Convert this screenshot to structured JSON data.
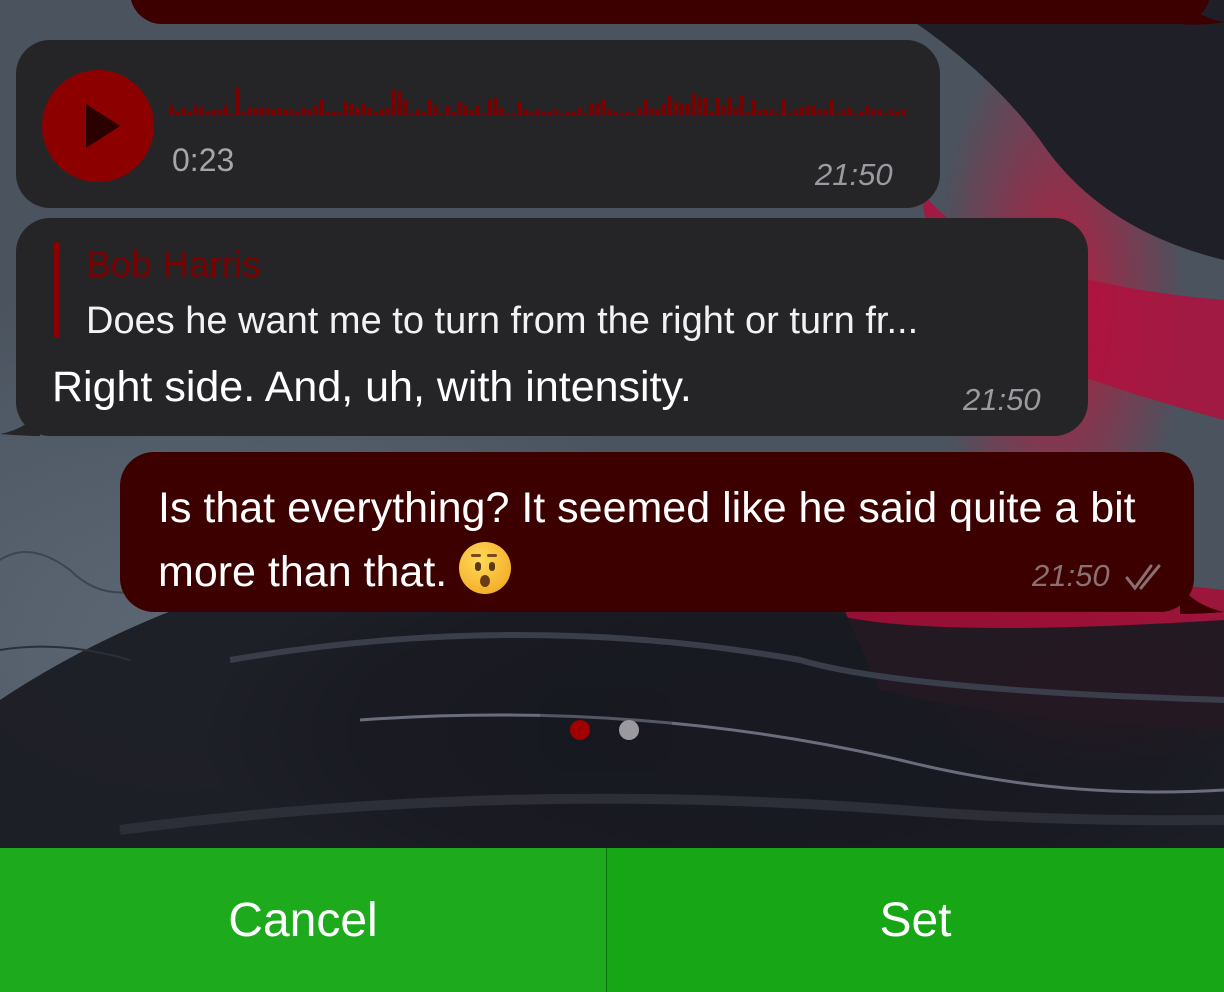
{
  "colors": {
    "incoming_bubble": "#252528",
    "outgoing_bubble": "#3c0000",
    "accent": "#8d0000",
    "action_bar": "#1aa81a"
  },
  "voice_message": {
    "duration": "0:23",
    "time": "21:50",
    "play_icon": "play-icon"
  },
  "reply_message": {
    "quoted_sender": "Bob Harris",
    "quoted_text": "Does he want me to turn from the right or turn fr...",
    "text": "Right side. And, uh, with intensity.",
    "time": "21:50"
  },
  "outgoing_message": {
    "text": "Is that everything? It seemed like he said quite a bit more than that.",
    "emoji": "hushed-face-emoji",
    "time": "21:50",
    "status_icon": "double-check-icon"
  },
  "pager": {
    "pages": 2,
    "active_index": 0
  },
  "actions": {
    "cancel_label": "Cancel",
    "set_label": "Set"
  }
}
